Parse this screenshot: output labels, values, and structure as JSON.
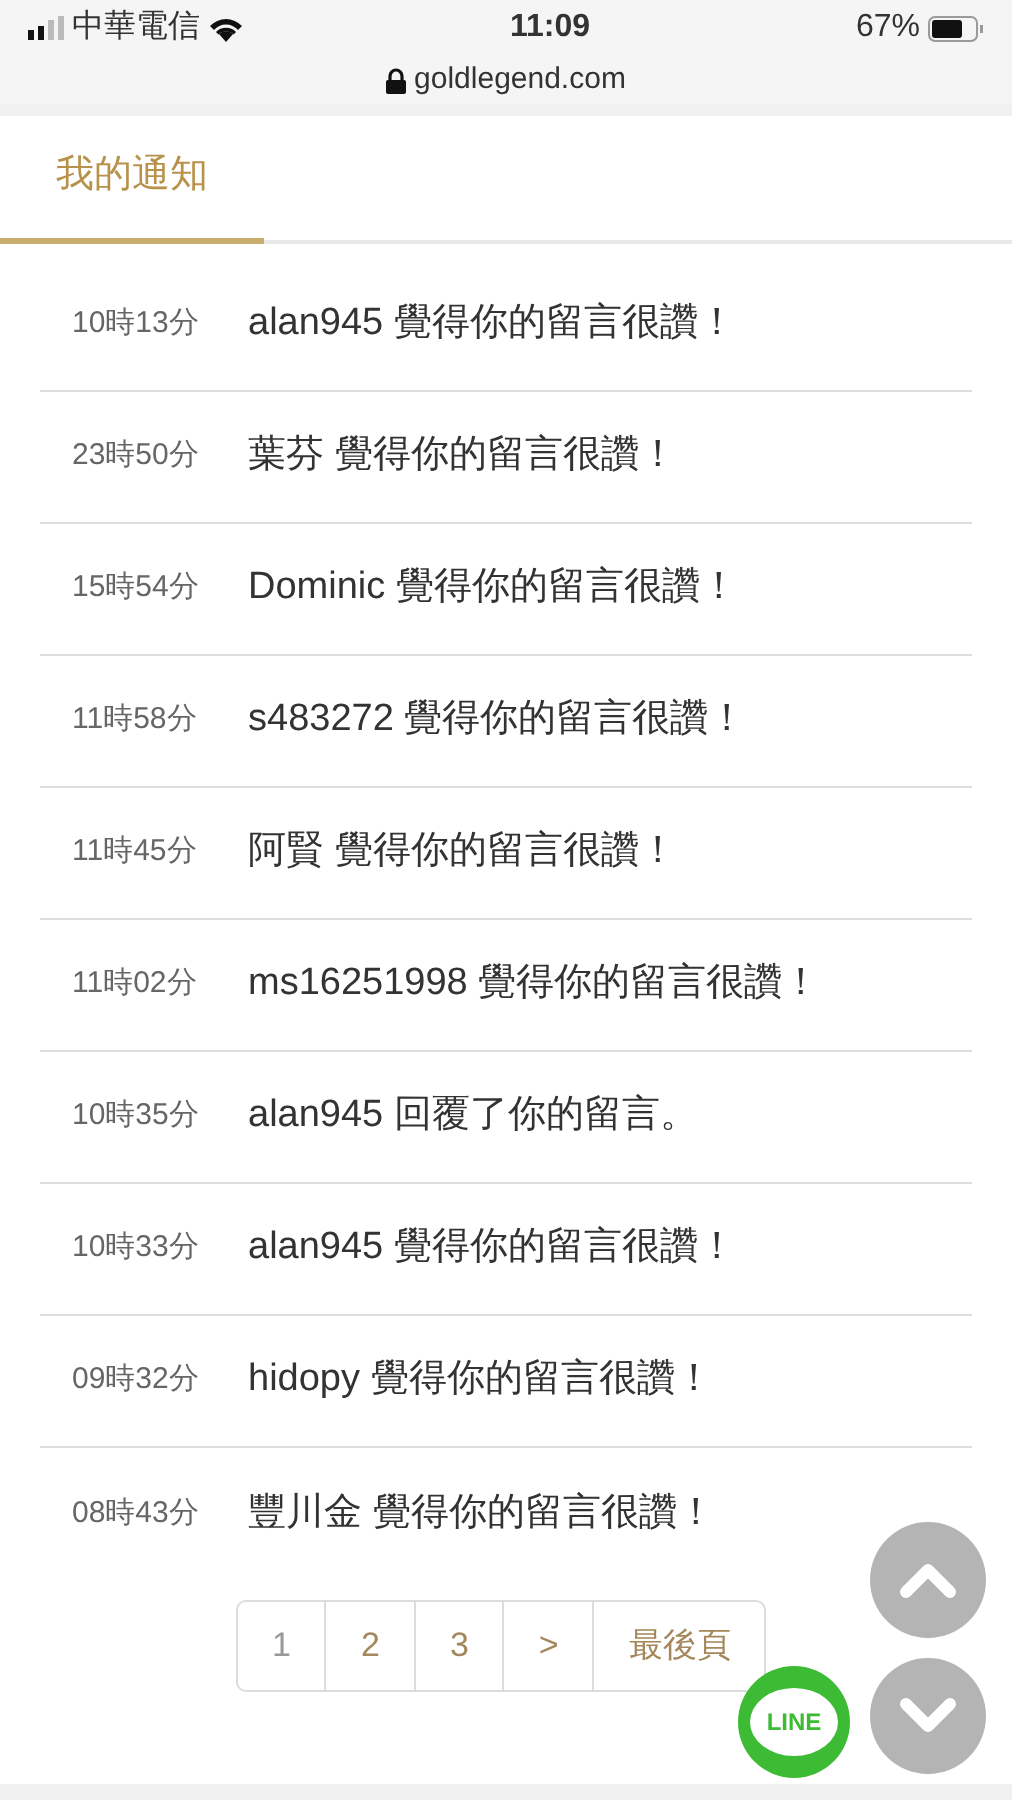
{
  "status_bar": {
    "carrier": "中華電信",
    "time": "11:09",
    "battery": "67%"
  },
  "address_bar": {
    "url": "goldlegend.com"
  },
  "tabs": [
    {
      "label": "我的通知",
      "selected": true
    }
  ],
  "notifications": [
    {
      "time": "10時13分",
      "text": "alan945 覺得你的留言很讚！"
    },
    {
      "time": "23時50分",
      "text": "葉芬 覺得你的留言很讚！"
    },
    {
      "time": "15時54分",
      "text": "Dominic 覺得你的留言很讚！"
    },
    {
      "time": "11時58分",
      "text": "s483272 覺得你的留言很讚！"
    },
    {
      "time": "11時45分",
      "text": "阿賢 覺得你的留言很讚！"
    },
    {
      "time": "11時02分",
      "text": "ms16251998 覺得你的留言很讚！"
    },
    {
      "time": "10時35分",
      "text": "alan945 回覆了你的留言。"
    },
    {
      "time": "10時33分",
      "text": "alan945 覺得你的留言很讚！"
    },
    {
      "time": "09時32分",
      "text": "hidopy 覺得你的留言很讚！"
    },
    {
      "time": "08時43分",
      "text": "豐川金 覺得你的留言很讚！"
    }
  ],
  "pagination": [
    {
      "label": "1",
      "selected": true
    },
    {
      "label": "2",
      "selected": false
    },
    {
      "label": "3",
      "selected": false
    },
    {
      "label": ">",
      "selected": false
    },
    {
      "label": "最後頁",
      "selected": false
    }
  ],
  "floating_buttons": {
    "line_label": "LINE"
  }
}
